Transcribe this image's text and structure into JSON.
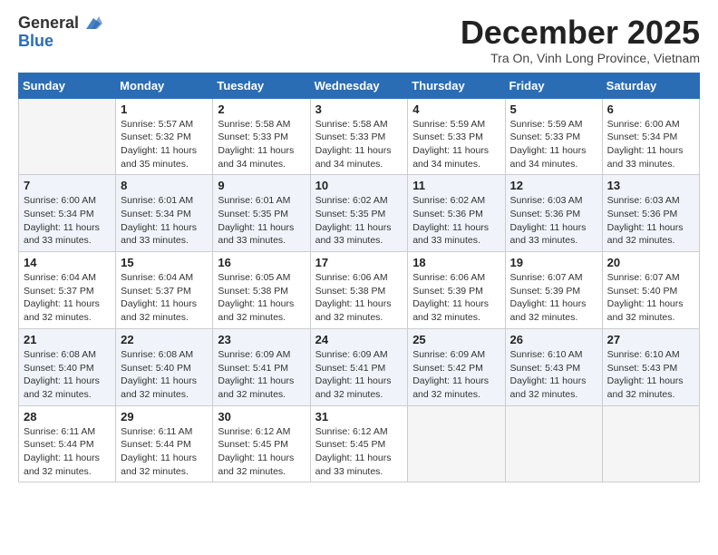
{
  "header": {
    "logo_general": "General",
    "logo_blue": "Blue",
    "month_title": "December 2025",
    "location": "Tra On, Vinh Long Province, Vietnam"
  },
  "weekdays": [
    "Sunday",
    "Monday",
    "Tuesday",
    "Wednesday",
    "Thursday",
    "Friday",
    "Saturday"
  ],
  "weeks": [
    [
      {
        "day": "",
        "empty": true
      },
      {
        "day": "1",
        "sunrise": "Sunrise: 5:57 AM",
        "sunset": "Sunset: 5:32 PM",
        "daylight": "Daylight: 11 hours and 35 minutes."
      },
      {
        "day": "2",
        "sunrise": "Sunrise: 5:58 AM",
        "sunset": "Sunset: 5:33 PM",
        "daylight": "Daylight: 11 hours and 34 minutes."
      },
      {
        "day": "3",
        "sunrise": "Sunrise: 5:58 AM",
        "sunset": "Sunset: 5:33 PM",
        "daylight": "Daylight: 11 hours and 34 minutes."
      },
      {
        "day": "4",
        "sunrise": "Sunrise: 5:59 AM",
        "sunset": "Sunset: 5:33 PM",
        "daylight": "Daylight: 11 hours and 34 minutes."
      },
      {
        "day": "5",
        "sunrise": "Sunrise: 5:59 AM",
        "sunset": "Sunset: 5:33 PM",
        "daylight": "Daylight: 11 hours and 34 minutes."
      },
      {
        "day": "6",
        "sunrise": "Sunrise: 6:00 AM",
        "sunset": "Sunset: 5:34 PM",
        "daylight": "Daylight: 11 hours and 33 minutes."
      }
    ],
    [
      {
        "day": "7",
        "sunrise": "Sunrise: 6:00 AM",
        "sunset": "Sunset: 5:34 PM",
        "daylight": "Daylight: 11 hours and 33 minutes."
      },
      {
        "day": "8",
        "sunrise": "Sunrise: 6:01 AM",
        "sunset": "Sunset: 5:34 PM",
        "daylight": "Daylight: 11 hours and 33 minutes."
      },
      {
        "day": "9",
        "sunrise": "Sunrise: 6:01 AM",
        "sunset": "Sunset: 5:35 PM",
        "daylight": "Daylight: 11 hours and 33 minutes."
      },
      {
        "day": "10",
        "sunrise": "Sunrise: 6:02 AM",
        "sunset": "Sunset: 5:35 PM",
        "daylight": "Daylight: 11 hours and 33 minutes."
      },
      {
        "day": "11",
        "sunrise": "Sunrise: 6:02 AM",
        "sunset": "Sunset: 5:36 PM",
        "daylight": "Daylight: 11 hours and 33 minutes."
      },
      {
        "day": "12",
        "sunrise": "Sunrise: 6:03 AM",
        "sunset": "Sunset: 5:36 PM",
        "daylight": "Daylight: 11 hours and 33 minutes."
      },
      {
        "day": "13",
        "sunrise": "Sunrise: 6:03 AM",
        "sunset": "Sunset: 5:36 PM",
        "daylight": "Daylight: 11 hours and 32 minutes."
      }
    ],
    [
      {
        "day": "14",
        "sunrise": "Sunrise: 6:04 AM",
        "sunset": "Sunset: 5:37 PM",
        "daylight": "Daylight: 11 hours and 32 minutes."
      },
      {
        "day": "15",
        "sunrise": "Sunrise: 6:04 AM",
        "sunset": "Sunset: 5:37 PM",
        "daylight": "Daylight: 11 hours and 32 minutes."
      },
      {
        "day": "16",
        "sunrise": "Sunrise: 6:05 AM",
        "sunset": "Sunset: 5:38 PM",
        "daylight": "Daylight: 11 hours and 32 minutes."
      },
      {
        "day": "17",
        "sunrise": "Sunrise: 6:06 AM",
        "sunset": "Sunset: 5:38 PM",
        "daylight": "Daylight: 11 hours and 32 minutes."
      },
      {
        "day": "18",
        "sunrise": "Sunrise: 6:06 AM",
        "sunset": "Sunset: 5:39 PM",
        "daylight": "Daylight: 11 hours and 32 minutes."
      },
      {
        "day": "19",
        "sunrise": "Sunrise: 6:07 AM",
        "sunset": "Sunset: 5:39 PM",
        "daylight": "Daylight: 11 hours and 32 minutes."
      },
      {
        "day": "20",
        "sunrise": "Sunrise: 6:07 AM",
        "sunset": "Sunset: 5:40 PM",
        "daylight": "Daylight: 11 hours and 32 minutes."
      }
    ],
    [
      {
        "day": "21",
        "sunrise": "Sunrise: 6:08 AM",
        "sunset": "Sunset: 5:40 PM",
        "daylight": "Daylight: 11 hours and 32 minutes."
      },
      {
        "day": "22",
        "sunrise": "Sunrise: 6:08 AM",
        "sunset": "Sunset: 5:40 PM",
        "daylight": "Daylight: 11 hours and 32 minutes."
      },
      {
        "day": "23",
        "sunrise": "Sunrise: 6:09 AM",
        "sunset": "Sunset: 5:41 PM",
        "daylight": "Daylight: 11 hours and 32 minutes."
      },
      {
        "day": "24",
        "sunrise": "Sunrise: 6:09 AM",
        "sunset": "Sunset: 5:41 PM",
        "daylight": "Daylight: 11 hours and 32 minutes."
      },
      {
        "day": "25",
        "sunrise": "Sunrise: 6:09 AM",
        "sunset": "Sunset: 5:42 PM",
        "daylight": "Daylight: 11 hours and 32 minutes."
      },
      {
        "day": "26",
        "sunrise": "Sunrise: 6:10 AM",
        "sunset": "Sunset: 5:43 PM",
        "daylight": "Daylight: 11 hours and 32 minutes."
      },
      {
        "day": "27",
        "sunrise": "Sunrise: 6:10 AM",
        "sunset": "Sunset: 5:43 PM",
        "daylight": "Daylight: 11 hours and 32 minutes."
      }
    ],
    [
      {
        "day": "28",
        "sunrise": "Sunrise: 6:11 AM",
        "sunset": "Sunset: 5:44 PM",
        "daylight": "Daylight: 11 hours and 32 minutes."
      },
      {
        "day": "29",
        "sunrise": "Sunrise: 6:11 AM",
        "sunset": "Sunset: 5:44 PM",
        "daylight": "Daylight: 11 hours and 32 minutes."
      },
      {
        "day": "30",
        "sunrise": "Sunrise: 6:12 AM",
        "sunset": "Sunset: 5:45 PM",
        "daylight": "Daylight: 11 hours and 32 minutes."
      },
      {
        "day": "31",
        "sunrise": "Sunrise: 6:12 AM",
        "sunset": "Sunset: 5:45 PM",
        "daylight": "Daylight: 11 hours and 33 minutes."
      },
      {
        "day": "",
        "empty": true
      },
      {
        "day": "",
        "empty": true
      },
      {
        "day": "",
        "empty": true
      }
    ]
  ]
}
